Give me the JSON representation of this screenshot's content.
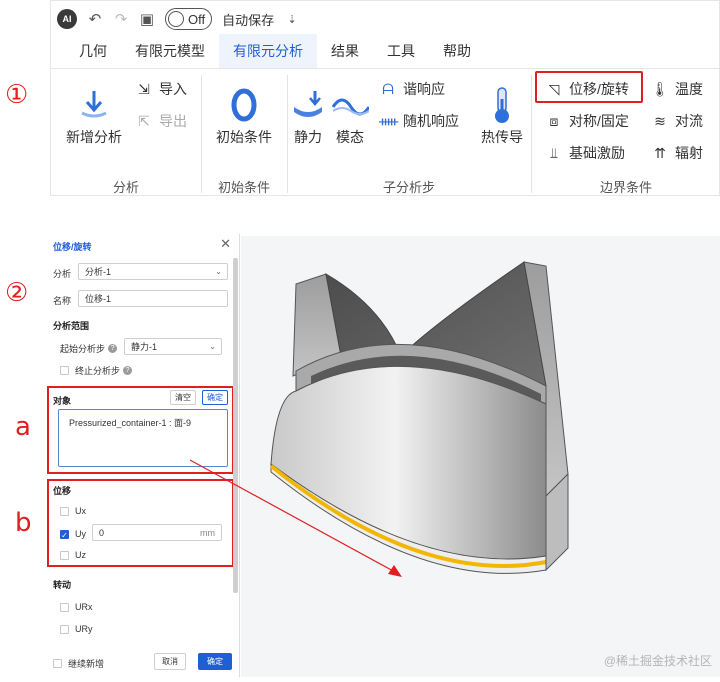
{
  "callouts": {
    "one": "①",
    "two": "②",
    "a": "a",
    "b": "b"
  },
  "titlebar": {
    "logo": "AI",
    "undo_icon": "↶",
    "redo_icon": "↷",
    "save_icon": "▣",
    "toggle_label": "Off",
    "autosave_label": "自动保存",
    "dropdown_icon": "⇣"
  },
  "menu": {
    "tabs": [
      "几何",
      "有限元模型",
      "有限元分析",
      "结果",
      "工具",
      "帮助"
    ],
    "active_index": 2
  },
  "ribbon": {
    "new_analysis": "新增分析",
    "import": "导入",
    "export": "导出",
    "group_analysis": "分析",
    "initial_conditions": "初始条件",
    "group_initial": "初始条件",
    "static": "静力",
    "modal": "模态",
    "harmonic": "谐响应",
    "random": "随机响应",
    "heat": "热传导",
    "group_substep": "子分析步",
    "displacement": "位移/旋转",
    "symmetry": "对称/固定",
    "base_excitation": "基础激励",
    "temperature": "温度",
    "convection": "对流",
    "radiation": "辐射",
    "group_boundary": "边界条件"
  },
  "panel": {
    "title": "位移/旋转",
    "close_icon": "✕",
    "analysis_label": "分析",
    "analysis_value": "分析-1",
    "name_label": "名称",
    "name_value": "位移-1",
    "scope_section": "分析范围",
    "start_step_label": "起始分析步",
    "start_step_value": "静力-1",
    "end_step_label": "终止分析步",
    "object_section": "对象",
    "clear_btn": "清空",
    "confirm_small_btn": "确定",
    "object_value": "Pressurized_container-1 : 面-9",
    "displacement_section": "位移",
    "ux": "Ux",
    "uy": "Uy",
    "uy_value": "0",
    "uy_unit": "mm",
    "uz": "Uz",
    "rotation_section": "转动",
    "urx": "URx",
    "ury": "URy",
    "continue_label": "继续新增",
    "cancel_btn": "取消",
    "ok_btn": "确定"
  },
  "watermark": "@稀土掘金技术社区",
  "colors": {
    "accent": "#1e5fd6",
    "highlight": "#e02020",
    "edge": "#f2b705"
  }
}
